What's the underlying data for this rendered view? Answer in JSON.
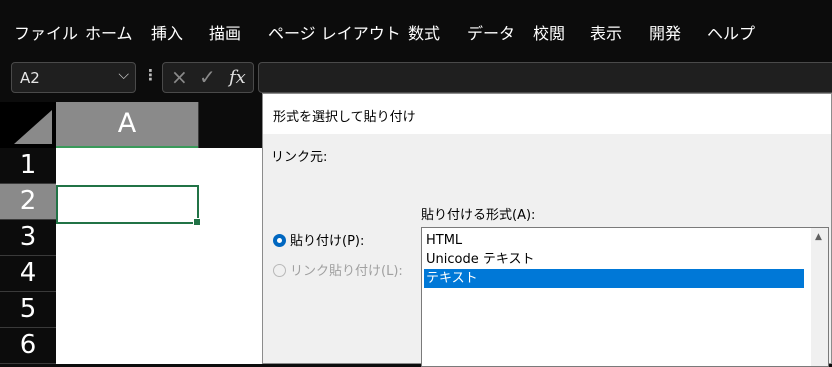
{
  "ribbon": {
    "tabs": [
      "ファイル",
      "ホーム",
      "挿入",
      "描画",
      "ページ レイアウト",
      "数式",
      "データ",
      "校閲",
      "表示",
      "開発",
      "ヘルプ"
    ]
  },
  "formula_bar": {
    "name_box": "A2",
    "cancel_icon": "×",
    "enter_icon": "✓",
    "fx_label": "fx",
    "formula": ""
  },
  "sheet": {
    "column_header": "A",
    "rows": [
      "1",
      "2",
      "3",
      "4",
      "5",
      "6"
    ],
    "selected_row": "2",
    "active_cell": "A2"
  },
  "dialog": {
    "title": "形式を選択して貼り付け",
    "link_source_label": "リンク元:",
    "as_label": "貼り付ける形式(A):",
    "options": {
      "paste": "貼り付け(P):",
      "paste_link": "リンク貼り付け(L):"
    },
    "formats": [
      "HTML",
      "Unicode テキスト",
      "テキスト"
    ],
    "selected_format": "テキスト"
  },
  "colors": {
    "accent": "#0078d7",
    "cell_border": "#217346",
    "header_selected": "#8a8a8a"
  }
}
